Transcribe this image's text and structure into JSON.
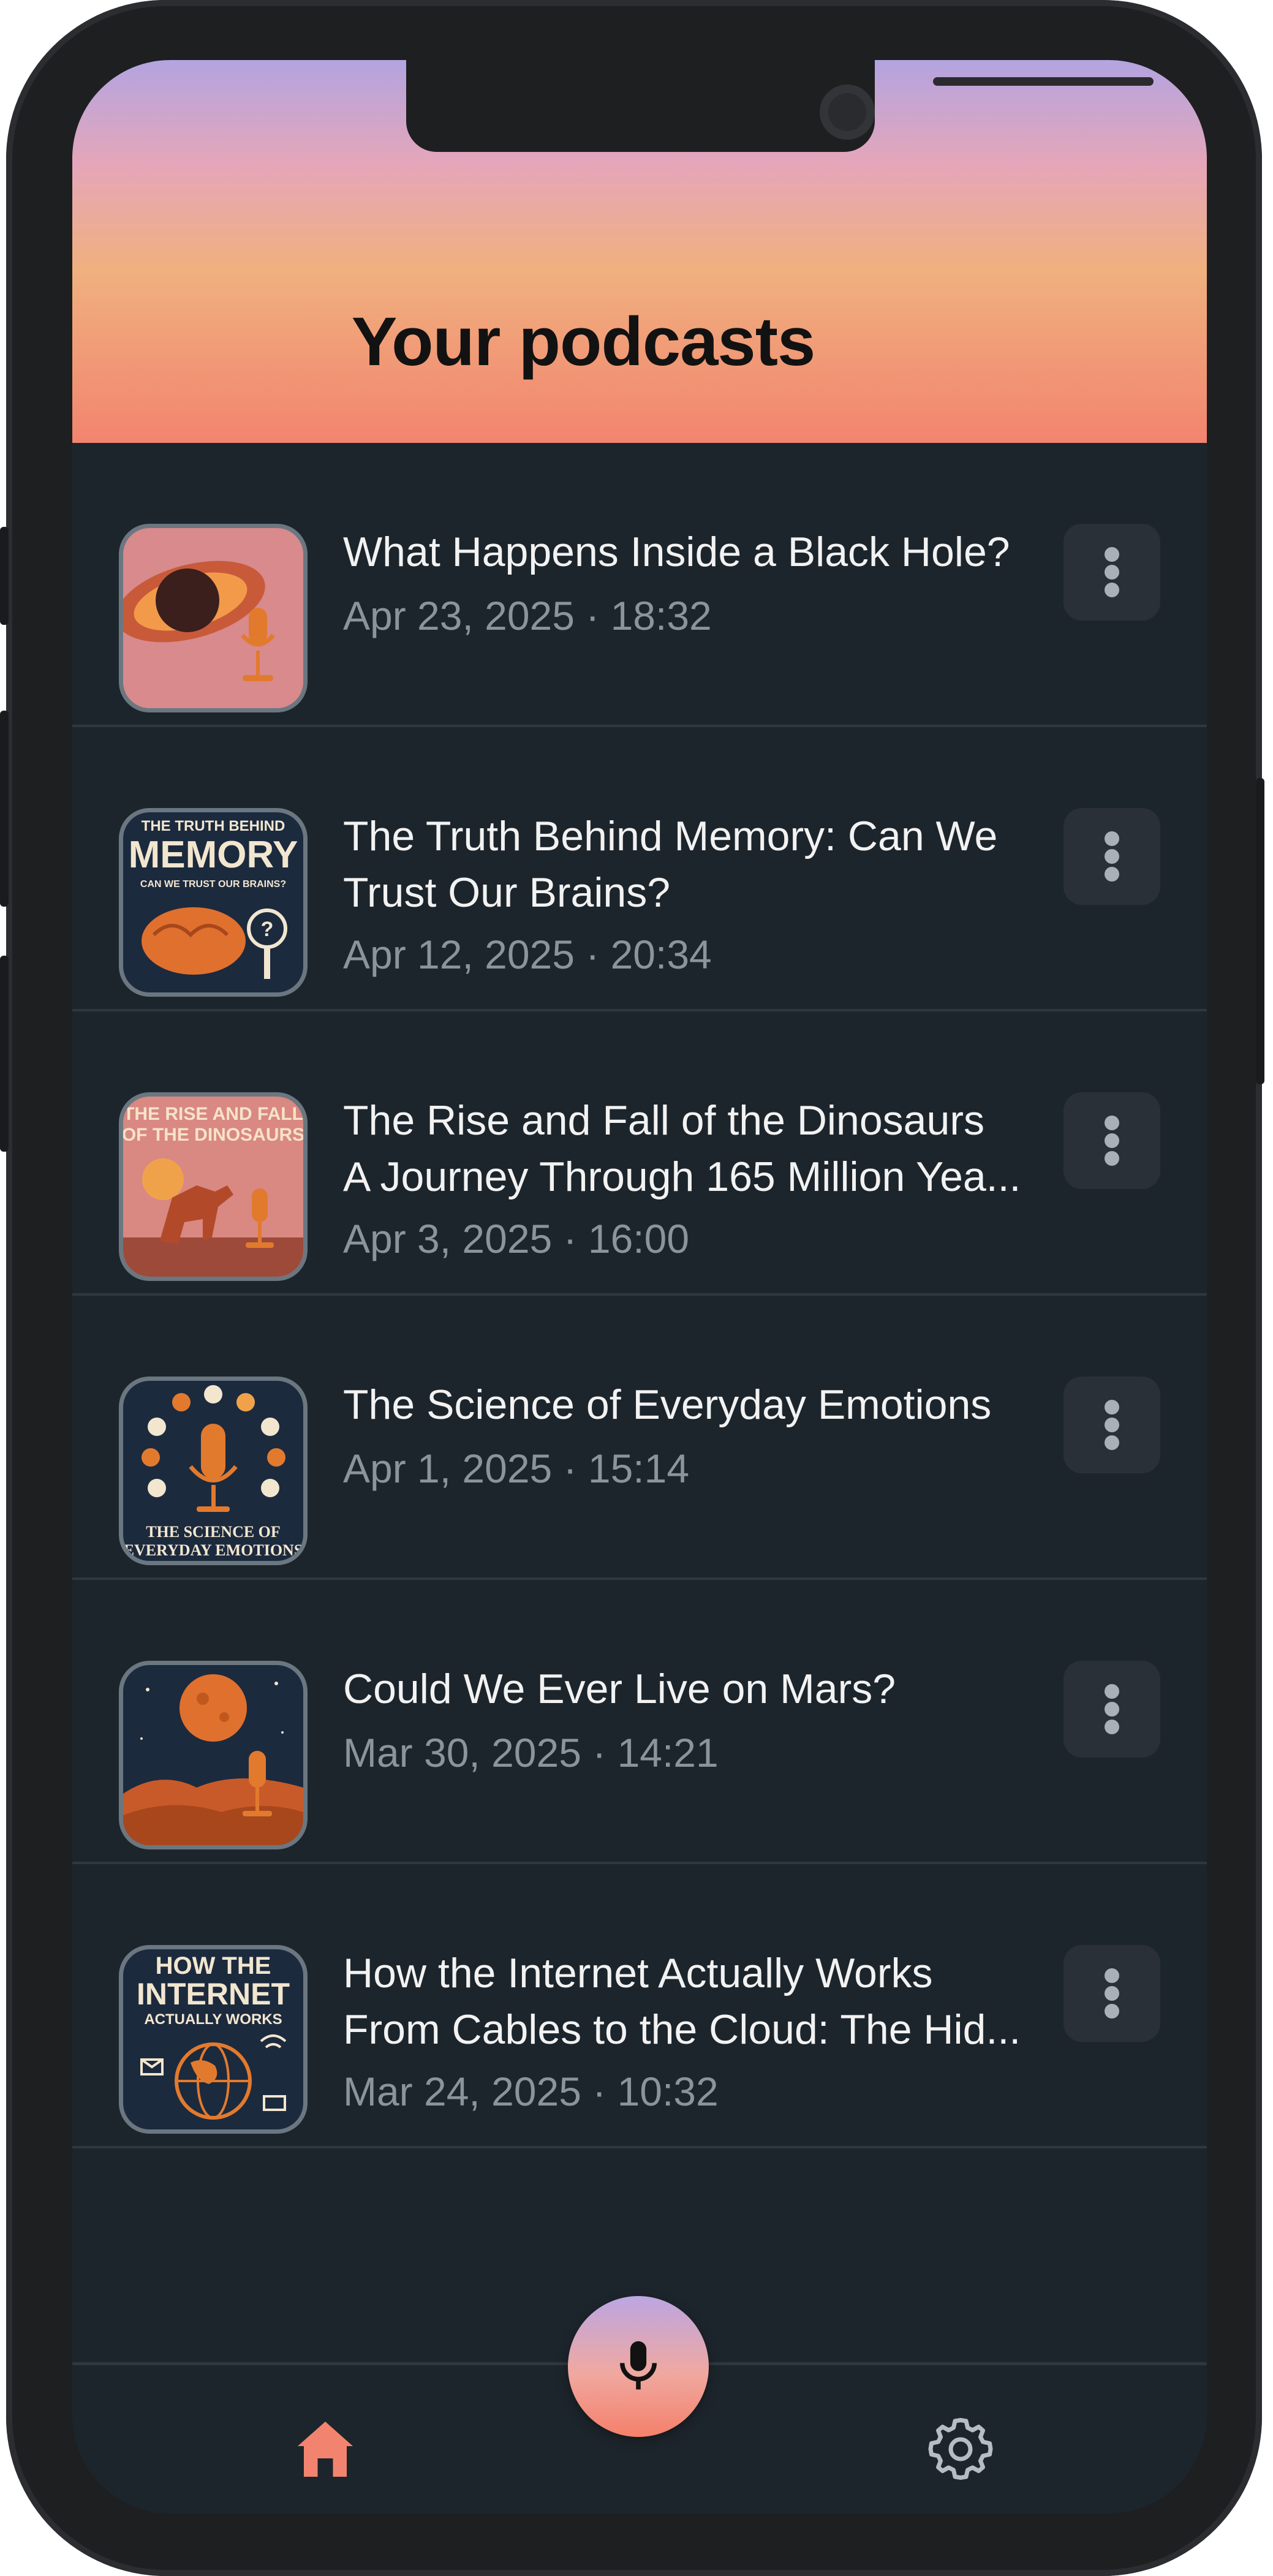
{
  "header": {
    "title": "Your podcasts"
  },
  "podcasts": [
    {
      "title_lines": [
        "What Happens Inside a Black Hole?"
      ],
      "date": "Apr 23, 2025 · 18:32",
      "thumb_icon": "black-hole-mic-icon"
    },
    {
      "title_lines": [
        "The Truth Behind Memory: Can We",
        "Trust Our Brains?"
      ],
      "date": "Apr 12, 2025 · 20:34",
      "thumb_icon": "memory-brain-icon",
      "thumb_text": [
        "THE TRUTH BEHIND",
        "MEMORY",
        "CAN WE TRUST OUR BRAINS?"
      ]
    },
    {
      "title_lines": [
        "The Rise and Fall of the Dinosaurs",
        "A Journey Through 165 Million Yea..."
      ],
      "date": "Apr 3, 2025 · 16:00",
      "thumb_icon": "dinosaur-icon",
      "thumb_text": [
        "THE RISE AND FALL",
        "OF THE DINOSAURS"
      ]
    },
    {
      "title_lines": [
        "The Science of Everyday Emotions"
      ],
      "date": "Apr 1, 2025 · 15:14",
      "thumb_icon": "emotions-mic-icon",
      "thumb_text": [
        "THE SCIENCE OF",
        "EVERYDAY EMOTIONS"
      ]
    },
    {
      "title_lines": [
        "Could We Ever Live on Mars?"
      ],
      "date": "Mar 30, 2025 · 14:21",
      "thumb_icon": "mars-mic-icon"
    },
    {
      "title_lines": [
        "How the Internet Actually Works",
        "From Cables to the Cloud: The Hid..."
      ],
      "date": "Mar 24, 2025 · 10:32",
      "thumb_icon": "internet-globe-icon",
      "thumb_text": [
        "HOW THE",
        "INTERNET",
        "ACTUALLY WORKS"
      ]
    }
  ],
  "nav": {
    "home_icon": "home-icon",
    "settings_icon": "gear-icon",
    "record_icon": "microphone-icon"
  },
  "colors": {
    "accent": "#f2846f",
    "background": "#1d252c",
    "text": "#f2f2f2",
    "muted": "#8b949b"
  }
}
